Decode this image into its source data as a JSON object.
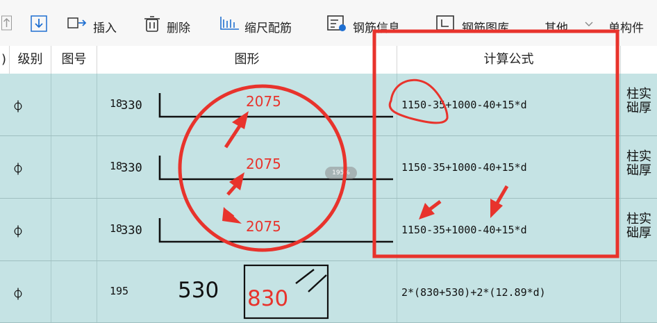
{
  "toolbar": {
    "items": [
      {
        "label": "插入",
        "icon": "insert-icon"
      },
      {
        "label": "删除",
        "icon": "delete-icon"
      },
      {
        "label": "缩尺配筋",
        "icon": "scale-icon"
      },
      {
        "label": "钢筋信息",
        "icon": "rebar-info-icon"
      },
      {
        "label": "钢筋图库",
        "icon": "rebar-library-icon"
      },
      {
        "label": "其他",
        "icon": "chevron-down-icon"
      },
      {
        "label": "单构件",
        "icon": ""
      }
    ]
  },
  "columns": [
    "级别",
    "图号",
    "图形",
    "计算公式"
  ],
  "header_partial": ")",
  "rows": [
    {
      "grade": "⏀",
      "figure_no": "18",
      "shape_left": "330",
      "shape_value": "2075",
      "formula": "1150-35+1000-40+15*d",
      "remark": [
        "柱实",
        "础厚"
      ]
    },
    {
      "grade": "⏀",
      "figure_no": "18",
      "shape_left": "330",
      "shape_value": "2075",
      "formula": "1150-35+1000-40+15*d",
      "remark": [
        "柱实",
        "础厚"
      ]
    },
    {
      "grade": "⏀",
      "figure_no": "18",
      "shape_left": "330",
      "shape_value": "2075",
      "formula": "1150-35+1000-40+15*d",
      "remark": [
        "柱实",
        "础厚"
      ]
    },
    {
      "grade": "⏀",
      "figure_no": "195",
      "shape_left": "530",
      "shape_value": "830",
      "formula": "2*(830+530)+2*(12.89*d)",
      "remark": [
        "",
        ""
      ]
    }
  ],
  "zoom_badge": "195%",
  "colors": {
    "row_bg": "#c5e3e4",
    "annotation_red": "#e8332c"
  }
}
